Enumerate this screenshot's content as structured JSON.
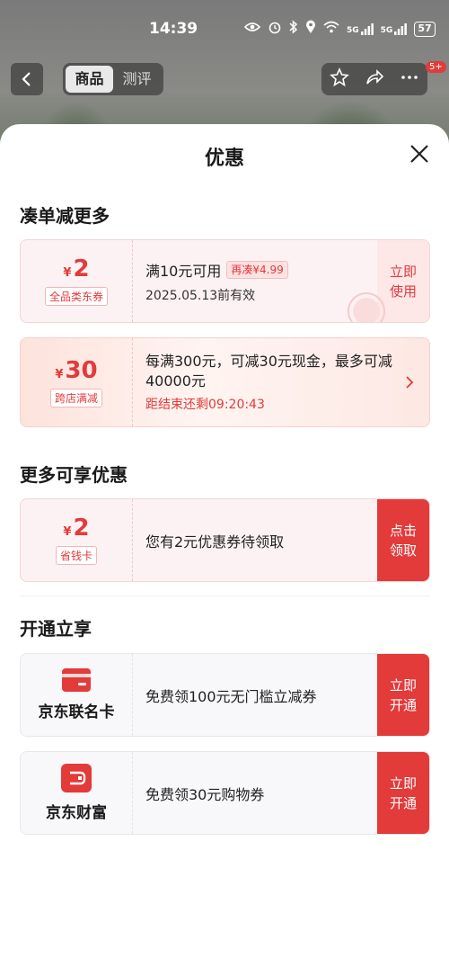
{
  "status_bar": {
    "time": "14:39",
    "signal1": "5G",
    "signal2": "5G",
    "battery": "57"
  },
  "top_nav": {
    "tabs": [
      "商品",
      "测评"
    ],
    "badge": "5+"
  },
  "sheet": {
    "title": "优惠",
    "section1": {
      "title": "凑单减更多",
      "coupon": {
        "yen": "¥",
        "amount": "2",
        "tag": "全品类东券",
        "line1": "满10元可用",
        "chip": "再凑¥4.99",
        "line2": "2025.05.13前有效",
        "action_l1": "立即",
        "action_l2": "使用"
      },
      "promo": {
        "yen": "¥",
        "amount": "30",
        "tag": "跨店满减",
        "text": "每满300元，可减30元现金，最多可减40000元",
        "countdown": "距结束还剩09:20:43"
      }
    },
    "section2": {
      "title": "更多可享优惠",
      "card": {
        "yen": "¥",
        "amount": "2",
        "tag": "省钱卡",
        "text": "您有2元优惠券待领取",
        "action_l1": "点击",
        "action_l2": "领取"
      }
    },
    "section3": {
      "title": "开通立享",
      "items": [
        {
          "brand": "京东联名卡",
          "text": "免费领100元无门槛立减券",
          "action_l1": "立即",
          "action_l2": "开通"
        },
        {
          "brand": "京东财富",
          "text": "免费领30元购物券",
          "action_l1": "立即",
          "action_l2": "开通"
        }
      ]
    }
  },
  "colors": {
    "accent": "#e33a3a",
    "accent_light": "#fde7e7"
  }
}
